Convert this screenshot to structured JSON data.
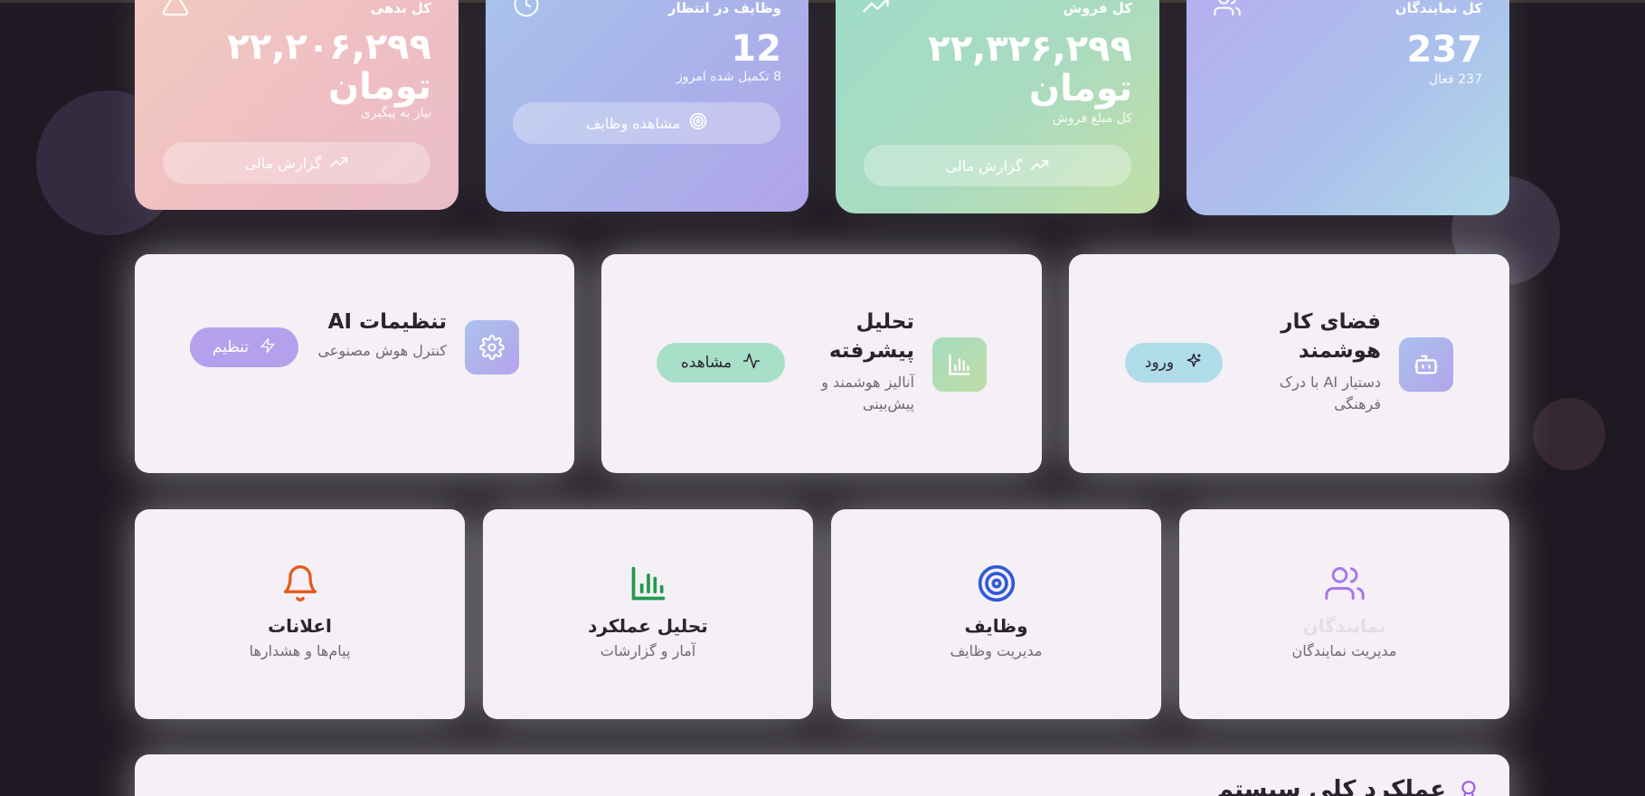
{
  "stats": [
    {
      "label": "کل نمایندگان",
      "value": "237",
      "sub": "237 فعال",
      "icon": "users-icon"
    },
    {
      "label": "کل فروش",
      "value": "۲۲,۳۲۶,۲۹۹ تومان",
      "sub": "کل مبلغ فروش",
      "button": "گزارش مالی",
      "icon": "trending-up-icon"
    },
    {
      "label": "وظایف در انتظار",
      "value": "12",
      "sub": "8 تکمیل شده امروز",
      "button": "مشاهده وظایف",
      "icon": "clock-icon"
    },
    {
      "label": "کل بدهی",
      "value": "۲۲,۲۰۶,۲۹۹ تومان",
      "sub": "نیاز به پیگیری",
      "button": "گزارش مالی",
      "icon": "alert-triangle-icon"
    }
  ],
  "features": [
    {
      "title": "فضای کار هوشمند",
      "desc": "دستیار AI با درک فرهنگی",
      "button": "ورود",
      "icon": "bot-icon",
      "button_icon": "sparkles-icon"
    },
    {
      "title": "تحلیل پیشرفته",
      "desc": "آنالیز هوشمند و پیش‌بینی",
      "button": "مشاهده",
      "icon": "bar-chart-icon",
      "button_icon": "activity-icon"
    },
    {
      "title": "تنظیمات AI",
      "desc": "کنترل هوش مصنوعی",
      "button": "تنظیم",
      "icon": "settings-icon",
      "button_icon": "zap-icon"
    }
  ],
  "nav": [
    {
      "title": "نمایندگان",
      "desc": "مدیریت نمایندگان",
      "icon": "users-icon",
      "color": "#a875ea"
    },
    {
      "title": "وظایف",
      "desc": "مدیریت وظایف",
      "icon": "target-icon",
      "color": "#2f59d8"
    },
    {
      "title": "تحلیل عملکرد",
      "desc": "آمار و گزارشات",
      "icon": "bar-chart-icon",
      "color": "#1f9a4c"
    },
    {
      "title": "اعلانات",
      "desc": "پیام‌ها و هشدارها",
      "icon": "bell-icon",
      "color": "#e5581c"
    }
  ],
  "bottom": {
    "title": "عملکرد کلی سیستم",
    "icon": "award-icon"
  }
}
